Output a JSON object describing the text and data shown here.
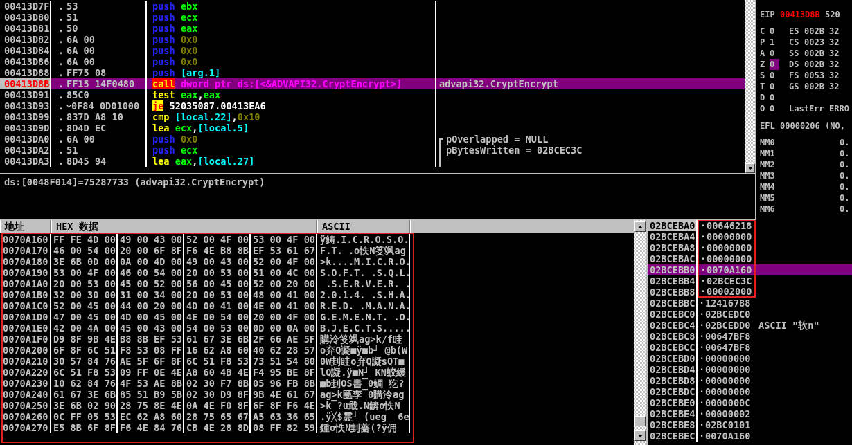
{
  "disassembly": {
    "rows": [
      {
        "address": "00413D7F",
        "marker": ".",
        "jump": false,
        "bytes": "53",
        "tokens": [
          {
            "text": "push",
            "kind": "push"
          },
          {
            "text": "ebx",
            "kind": "reg"
          }
        ],
        "selected": false
      },
      {
        "address": "00413D80",
        "marker": ".",
        "jump": false,
        "bytes": "51",
        "tokens": [
          {
            "text": "push",
            "kind": "push"
          },
          {
            "text": "ecx",
            "kind": "reg"
          }
        ],
        "selected": false
      },
      {
        "address": "00413D81",
        "marker": ".",
        "jump": false,
        "bytes": "50",
        "tokens": [
          {
            "text": "push",
            "kind": "push"
          },
          {
            "text": "eax",
            "kind": "reg"
          }
        ],
        "selected": false
      },
      {
        "address": "00413D82",
        "marker": ".",
        "jump": false,
        "bytes": "6A 00",
        "tokens": [
          {
            "text": "push",
            "kind": "push"
          },
          {
            "text": "0x0",
            "kind": "const"
          }
        ],
        "selected": false
      },
      {
        "address": "00413D84",
        "marker": ".",
        "jump": false,
        "bytes": "6A 00",
        "tokens": [
          {
            "text": "push",
            "kind": "push"
          },
          {
            "text": "0x0",
            "kind": "const"
          }
        ],
        "selected": false
      },
      {
        "address": "00413D86",
        "marker": ".",
        "jump": false,
        "bytes": "6A 00",
        "tokens": [
          {
            "text": "push",
            "kind": "push"
          },
          {
            "text": "0x0",
            "kind": "const"
          }
        ],
        "selected": false
      },
      {
        "address": "00413D88",
        "marker": ".",
        "jump": false,
        "bytes": "FF75 08",
        "tokens": [
          {
            "text": "push",
            "kind": "push"
          },
          {
            "text": "[arg.1]",
            "kind": "mem"
          }
        ],
        "selected": false
      },
      {
        "address": "00413D8B",
        "marker": ".",
        "jump": false,
        "bytes": "FF15 14F0480",
        "tokens": [
          {
            "text": "call",
            "kind": "call"
          },
          {
            "text": "dword ptr ds:[<&ADVAPI32.CryptEncrypt>]",
            "kind": "ref"
          }
        ],
        "comment": "advapi32.CryptEncrypt",
        "selected": true
      },
      {
        "address": "00413D91",
        "marker": ".",
        "jump": false,
        "bytes": "85C0",
        "tokens": [
          {
            "text": "test",
            "kind": "op"
          },
          {
            "text": "eax",
            "kind": "reg"
          },
          {
            "text": ",",
            "kind": "punct"
          },
          {
            "text": "eax",
            "kind": "reg"
          }
        ],
        "selected": false
      },
      {
        "address": "00413D93",
        "marker": ".",
        "jump": true,
        "bytes": "0F84 0D01000",
        "tokens": [
          {
            "text": "je",
            "kind": "jump"
          },
          {
            "text": "52035087.00413EA6",
            "kind": "target"
          }
        ],
        "selected": false
      },
      {
        "address": "00413D99",
        "marker": ".",
        "jump": false,
        "bytes": "837D A8 10",
        "tokens": [
          {
            "text": "cmp",
            "kind": "op"
          },
          {
            "text": "[local.22]",
            "kind": "mem"
          },
          {
            "text": ",",
            "kind": "punct"
          },
          {
            "text": "0x10",
            "kind": "const"
          }
        ],
        "selected": false
      },
      {
        "address": "00413D9D",
        "marker": ".",
        "jump": false,
        "bytes": "8D4D EC",
        "tokens": [
          {
            "text": "lea",
            "kind": "op"
          },
          {
            "text": "ecx",
            "kind": "reg"
          },
          {
            "text": ",",
            "kind": "punct"
          },
          {
            "text": "[local.5]",
            "kind": "mem"
          }
        ],
        "selected": false
      },
      {
        "address": "00413DA0",
        "marker": ".",
        "jump": false,
        "bytes": "6A 00",
        "tokens": [
          {
            "text": "push",
            "kind": "push"
          },
          {
            "text": "0x0",
            "kind": "const"
          }
        ],
        "comment": "pOverlapped = NULL",
        "bracket": {
          "kind": "top"
        },
        "selected": false
      },
      {
        "address": "00413DA2",
        "marker": ".",
        "jump": false,
        "bytes": "51",
        "tokens": [
          {
            "text": "push",
            "kind": "push"
          },
          {
            "text": "ecx",
            "kind": "reg"
          }
        ],
        "comment": "pBytesWritten = 02BCEC3C",
        "bracket": {
          "kind": "side"
        },
        "selected": false
      },
      {
        "address": "00413DA3",
        "marker": ".",
        "jump": false,
        "bytes": "8D45 94",
        "tokens": [
          {
            "text": "lea",
            "kind": "op"
          },
          {
            "text": "eax",
            "kind": "reg"
          },
          {
            "text": ",",
            "kind": "punct"
          },
          {
            "text": "[local.27]",
            "kind": "mem"
          }
        ],
        "bracket": {
          "kind": "side"
        },
        "selected": false
      }
    ]
  },
  "info": "ds:[0048F014]=75287733 (advapi32.CryptEncrypt)",
  "registers": {
    "eip": {
      "name": "EIP",
      "value": "00413D8B",
      "symbol": "520"
    },
    "flags": [
      {
        "name": "C",
        "value": "0",
        "selected": false,
        "right": {
          "kind": "segment",
          "name": "ES",
          "value": "002B",
          "bits": "32"
        }
      },
      {
        "name": "P",
        "value": "1",
        "selected": false,
        "right": {
          "kind": "segment",
          "name": "CS",
          "value": "0023",
          "bits": "32"
        }
      },
      {
        "name": "A",
        "value": "0",
        "selected": false,
        "right": {
          "kind": "segment",
          "name": "SS",
          "value": "002B",
          "bits": "32"
        }
      },
      {
        "name": "Z",
        "value": "0",
        "selected": true,
        "right": {
          "kind": "segment",
          "name": "DS",
          "value": "002B",
          "bits": "32"
        }
      },
      {
        "name": "S",
        "value": "0",
        "selected": false,
        "right": {
          "kind": "segment",
          "name": "FS",
          "value": "0053",
          "bits": "32"
        }
      },
      {
        "name": "T",
        "value": "0",
        "selected": false,
        "right": {
          "kind": "segment",
          "name": "GS",
          "value": "002B",
          "bits": "32"
        }
      },
      {
        "name": "D",
        "value": "0",
        "selected": false
      },
      {
        "name": "O",
        "value": "0",
        "selected": false,
        "right": {
          "kind": "error",
          "name": "LastErr",
          "value": "ERRO"
        }
      }
    ],
    "efl": {
      "name": "EFL",
      "value": "00000206",
      "flags": "(NO,"
    },
    "mmx": [
      {
        "name": "MM0",
        "value": "0."
      },
      {
        "name": "MM1",
        "value": "0."
      },
      {
        "name": "MM2",
        "value": "0."
      },
      {
        "name": "MM3",
        "value": "0."
      },
      {
        "name": "MM4",
        "value": "0."
      },
      {
        "name": "MM5",
        "value": "0."
      },
      {
        "name": "MM6",
        "value": "0."
      }
    ]
  },
  "dump": {
    "framed": true,
    "columns": [
      "地址",
      "HEX 数据",
      "ASCII"
    ],
    "rows": [
      {
        "address": "0070A160",
        "hex": [
          "FF FE 4D 00",
          "49 00 43 00",
          "52 00 4F 00",
          "53 00 4F 00"
        ],
        "ascii": "ÿ鋳.I.C.R.O.S.O."
      },
      {
        "address": "0070A170",
        "hex": [
          "46 00 54 00",
          "20 00 6F 8F",
          "F6 4E B8 8B",
          "EF 53 61 67"
        ],
        "ascii": "F.T. .o怢N笅飒ag"
      },
      {
        "address": "0070A180",
        "hex": [
          "3E 6B 0D 00",
          "0A 00 4D 00",
          "49 00 43 00",
          "52 00 4F 00"
        ],
        "ascii": ">k....M.I.C.R.O."
      },
      {
        "address": "0070A190",
        "hex": [
          "53 00 4F 00",
          "46 00 54 00",
          "20 00 53 00",
          "51 00 4C 00"
        ],
        "ascii": "S.O.F.T. .S.Q.L."
      },
      {
        "address": "0070A1A0",
        "hex": [
          "20 00 53 00",
          "45 00 52 00",
          "56 00 45 00",
          "52 00 20 00"
        ],
        "ascii": " .S.E.R.V.E.R. ."
      },
      {
        "address": "0070A1B0",
        "hex": [
          "32 00 30 00",
          "31 00 34 00",
          "20 00 53 00",
          "48 00 41 00"
        ],
        "ascii": "2.0.1.4. .S.H.A."
      },
      {
        "address": "0070A1C0",
        "hex": [
          "52 00 45 00",
          "44 00 20 00",
          "4D 00 41 00",
          "4E 00 41 00"
        ],
        "ascii": "R.E.D. .M.A.N.A."
      },
      {
        "address": "0070A1D0",
        "hex": [
          "47 00 45 00",
          "4D 00 45 00",
          "4E 00 54 00",
          "20 00 4F 00"
        ],
        "ascii": "G.E.M.E.N.T. .O."
      },
      {
        "address": "0070A1E0",
        "hex": [
          "42 00 4A 00",
          "45 00 43 00",
          "54 00 53 00",
          "0D 00 0A 00"
        ],
        "ascii": "B.J.E.C.T.S....."
      },
      {
        "address": "0070A1F0",
        "hex": [
          "D9 8F 9B 4E",
          "B8 8B EF 53",
          "61 67 3E 6B",
          "2F 66 AE 5F"
        ],
        "ascii": "購泠笅飒ag>k/f眭"
      },
      {
        "address": "0070A200",
        "hex": [
          "6F 8F 6C 51",
          "F8 53 08 FF",
          "16 62 A8 60",
          "40 62 28 57"
        ],
        "ascii": "o弃Q譺■ÿ■b┘ @b(W"
      },
      {
        "address": "0070A210",
        "hex": [
          "30 57 84 76",
          "AE 5F 6F 8F",
          "6C 51 F8 53",
          "73 51 54 80"
        ],
        "ascii": "0W刲眭o弃Q譺sQT■"
      },
      {
        "address": "0070A220",
        "hex": [
          "6C 51 F8 53",
          "09 FF 0E 4E",
          "A8 60 4B 4E",
          "F4 95 BE 8F"
        ],
        "ascii": "lQ譺.ÿ■N┘ KN鮫緩"
      },
      {
        "address": "0070A230",
        "hex": [
          "10 62 84 76",
          "4F 53 AE 8B",
          "02 30 F7 8B",
          "05 96 FB 8B"
        ],
        "ascii": "■b刲OS書▔0鲷 犵?"
      },
      {
        "address": "0070A240",
        "hex": [
          "61 67 3E 6B",
          "85 51 B9 5B",
          "02 30 D9 8F",
          "9B 4E 61 67"
        ],
        "ascii": "ag>k匭孪▔0購泠ag"
      },
      {
        "address": "0070A250",
        "hex": [
          "3E 6B 02 90",
          "28 75 8E 4E",
          "0A 4E F0 8F",
          "6F 8F F6 4E"
        ],
        "ascii": ">k▔?u戢.N餴o怢N"
      },
      {
        "address": "0070A260",
        "hex": [
          "0C FF 05 53",
          "EC 62 A8 60",
          "28 75 65 67",
          "A5 63 36 65"
        ],
        "ascii": ".ÿ╳$霊┘ (ueg  6e"
      },
      {
        "address": "0070A270",
        "hex": [
          "E5 8B 6F 8F",
          "F6 4E 84 76",
          "CB 4E 28 8D",
          "08 FF 82 59"
        ],
        "ascii": "鍾o怢N刲薔(?ÿ佣"
      }
    ]
  },
  "stack": {
    "rows": [
      {
        "address": "02BCEBA0",
        "marker": "·",
        "value": "00646218",
        "top": true,
        "selected": false,
        "framed": true
      },
      {
        "address": "02BCEBA4",
        "marker": "·",
        "value": "00000000",
        "top": false,
        "selected": false,
        "framed": true
      },
      {
        "address": "02BCEBA8",
        "marker": "·",
        "value": "00000000",
        "top": false,
        "selected": false,
        "framed": true
      },
      {
        "address": "02BCEBAC",
        "marker": "·",
        "value": "00000000",
        "top": false,
        "selected": false,
        "framed": true
      },
      {
        "address": "02BCEBB0",
        "marker": "·",
        "value": "0070A160",
        "top": false,
        "selected": true,
        "framed": true
      },
      {
        "address": "02BCEBB4",
        "marker": "·",
        "value": "02BCEC3C",
        "top": false,
        "selected": false,
        "framed": true
      },
      {
        "address": "02BCEBB8",
        "marker": "·",
        "value": "00002000",
        "top": false,
        "selected": false,
        "framed": true
      },
      {
        "address": "02BCEBBC",
        "marker": "·",
        "value": "12416788",
        "top": false,
        "selected": false,
        "framed": false
      },
      {
        "address": "02BCEBC0",
        "marker": "·",
        "value": "02BCEDC0",
        "top": false,
        "selected": false,
        "framed": false
      },
      {
        "address": "02BCEBC4",
        "marker": "·",
        "value": "02BCEDD0",
        "comment": "ASCII \"软n\"",
        "top": false,
        "selected": false,
        "framed": false
      },
      {
        "address": "02BCEBC8",
        "marker": "·",
        "value": "00647BF8",
        "top": false,
        "selected": false,
        "framed": false
      },
      {
        "address": "02BCEBCC",
        "marker": "·",
        "value": "00647BF8",
        "top": false,
        "selected": false,
        "framed": false
      },
      {
        "address": "02BCEBD0",
        "marker": "·",
        "value": "00000000",
        "top": false,
        "selected": false,
        "framed": false
      },
      {
        "address": "02BCEBD4",
        "marker": "·",
        "value": "00000000",
        "top": false,
        "selected": false,
        "framed": false
      },
      {
        "address": "02BCEBD8",
        "marker": "·",
        "value": "00000000",
        "top": false,
        "selected": false,
        "framed": false
      },
      {
        "address": "02BCEBDC",
        "marker": "·",
        "value": "00000000",
        "top": false,
        "selected": false,
        "framed": false
      },
      {
        "address": "02BCEBE0",
        "marker": "·",
        "value": "0000000C",
        "top": false,
        "selected": false,
        "framed": false
      },
      {
        "address": "02BCEBE4",
        "marker": "·",
        "value": "00000002",
        "top": false,
        "selected": false,
        "framed": false
      },
      {
        "address": "02BCEBE8",
        "marker": "·",
        "value": "02BC0101",
        "top": false,
        "selected": false,
        "framed": false
      },
      {
        "address": "02BCEBEC",
        "marker": "·",
        "value": "0070A160",
        "top": false,
        "selected": false,
        "framed": false
      }
    ]
  }
}
